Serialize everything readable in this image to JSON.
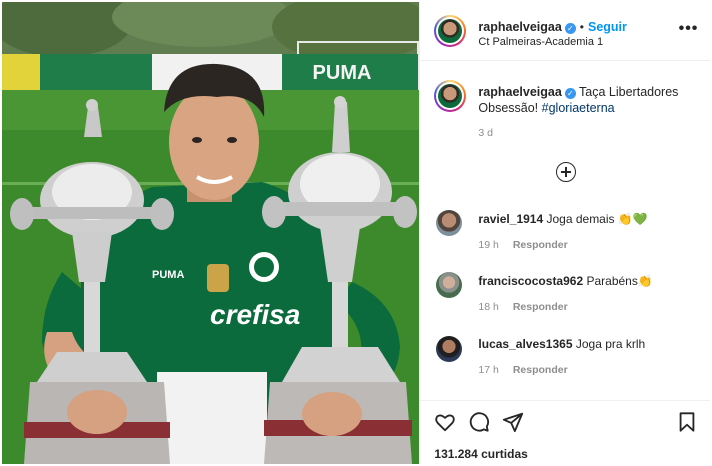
{
  "post": {
    "username": "raphaelveigaa",
    "follow_label": "Seguir",
    "separator": "•",
    "location": "Ct Palmeiras-Academia 1",
    "more_label": "•••"
  },
  "caption": {
    "username": "raphaelveigaa",
    "text": "Taça Libertadores Obsessão!",
    "hashtag": "#gloriaeterna",
    "time": "3 d"
  },
  "comments": [
    {
      "username": "raviel_1914",
      "text": "Joga demais 👏💚",
      "time": "19 h",
      "reply": "Responder"
    },
    {
      "username": "franciscocosta962",
      "text": "Parabéns👏",
      "time": "18 h",
      "reply": "Responder"
    },
    {
      "username": "lucas_alves1365",
      "text": "Joga pra krlh",
      "time": "17 h",
      "reply": "Responder"
    }
  ],
  "actions": {
    "icons": [
      "heart-icon",
      "comment-icon",
      "share-icon",
      "bookmark-icon"
    ],
    "likes": "131.284 curtidas"
  },
  "photo": {
    "ad_boards": [
      "",
      "",
      "PUMA"
    ],
    "shirt_sponsor": "crefisa",
    "shirt_brand": "PUMA"
  },
  "colors": {
    "accent": "#0095f6",
    "verified": "#3897f0",
    "hashtag": "#00376b",
    "meta_text": "#8e8e8e",
    "heart": "#3bb34a",
    "shirt_green": "#0b6b3c"
  }
}
